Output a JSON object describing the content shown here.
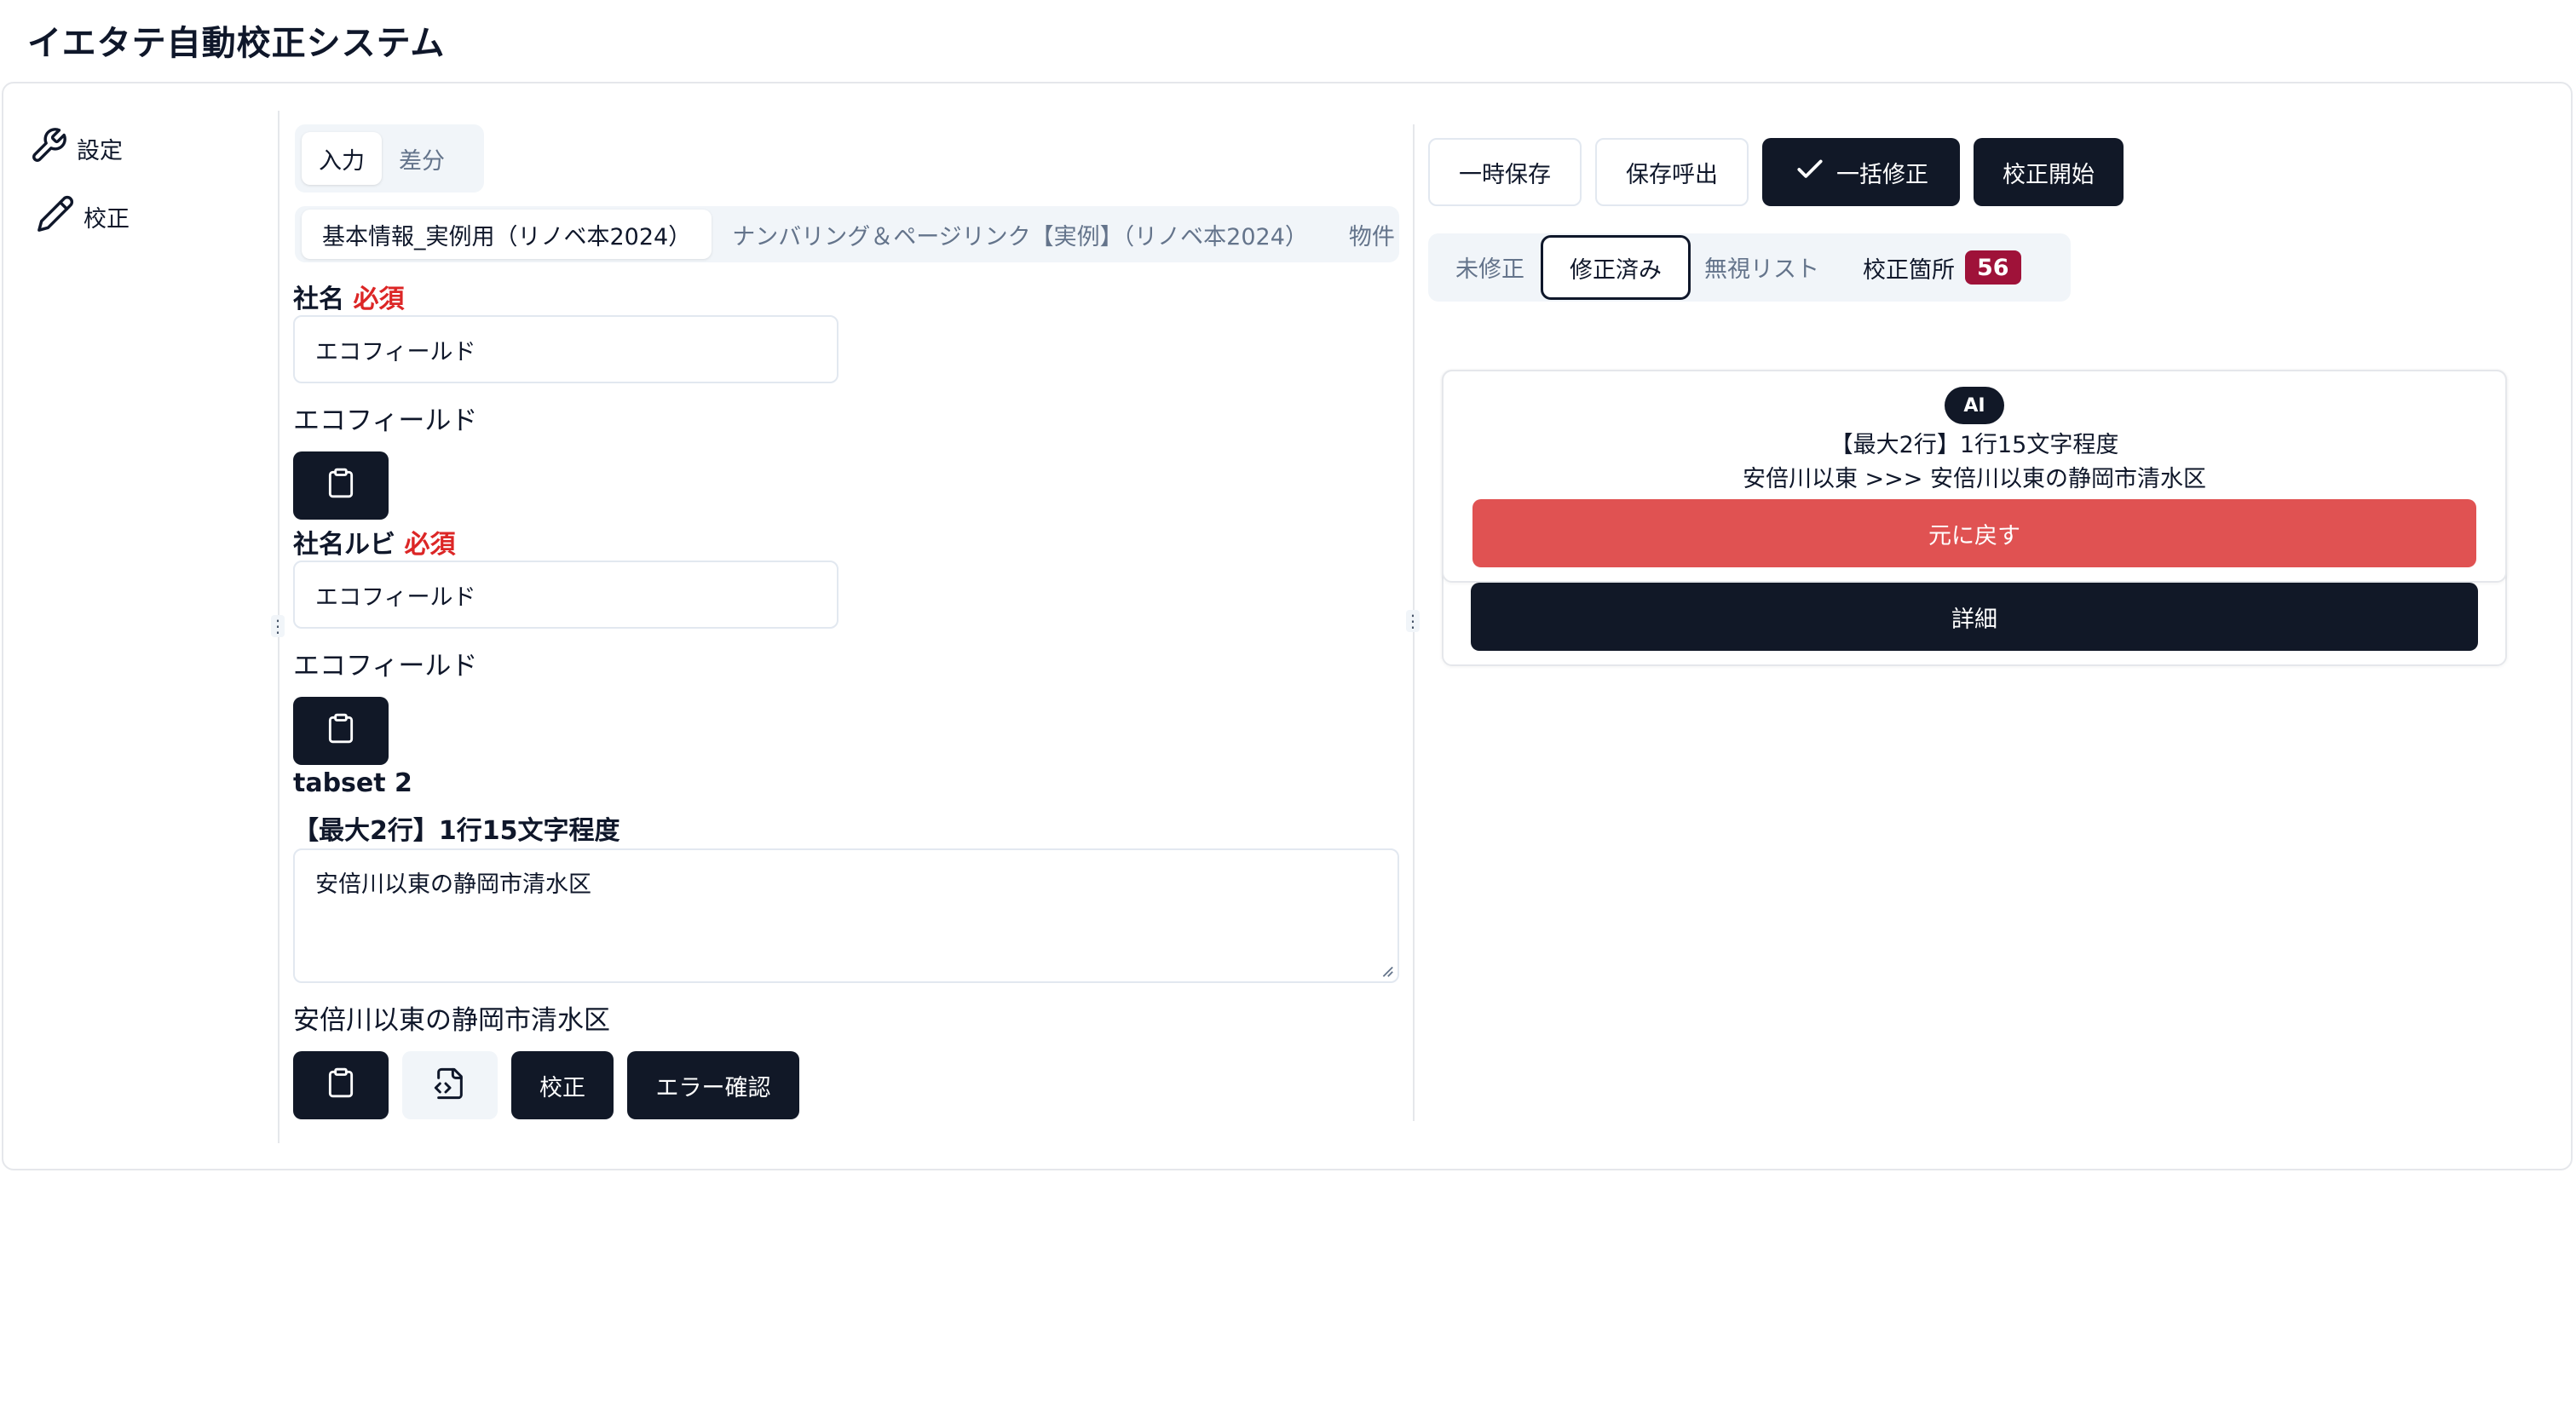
{
  "app_title": "イエタテ自動校正システム",
  "sidebar": {
    "items": [
      {
        "label": "設定",
        "icon": "wrench-icon"
      },
      {
        "label": "校正",
        "icon": "pencil-icon"
      }
    ]
  },
  "left": {
    "mode_tabs": [
      "入力",
      "差分"
    ],
    "active_mode": "入力",
    "section_tabs": [
      "基本情報_実例用（リノベ本2024）",
      "ナンバリング＆ページリンク【実例】（リノベ本2024）",
      "物件"
    ],
    "company": {
      "label": "社名",
      "required": "必須",
      "value": "エコフィールド",
      "preview": "エコフィールド"
    },
    "company_ruby": {
      "label": "社名ルビ",
      "required": "必須",
      "value": "エコフィールド",
      "preview": "エコフィールド"
    },
    "tabset_title": "tabset 2",
    "field3": {
      "label": "【最大2行】1行15文字程度",
      "value": "安倍川以東の静岡市清水区",
      "preview": "安倍川以東の静岡市清水区"
    },
    "proofread_button": "校正",
    "error_check_button": "エラー確認"
  },
  "right": {
    "toolbar": {
      "temp_save": "一時保存",
      "load_saved": "保存呼出",
      "bulk_fix": "一括修正",
      "start_proofread": "校正開始"
    },
    "filter_tabs": {
      "unfixed": "未修正",
      "fixed": "修正済み",
      "ignore": "無視リスト",
      "locations": "校正箇所",
      "count": "56"
    },
    "result_card": {
      "badge": "AI",
      "field_name": "【最大2行】1行15文字程度",
      "change": "安倍川以東 >>> 安倍川以東の静岡市清水区",
      "revert_button": "元に戻す",
      "detail_button": "詳細"
    }
  },
  "colors": {
    "dark": "#111827",
    "required_red": "#dc2626",
    "revert_red": "#e05252",
    "count_badge": "#9f1239"
  }
}
